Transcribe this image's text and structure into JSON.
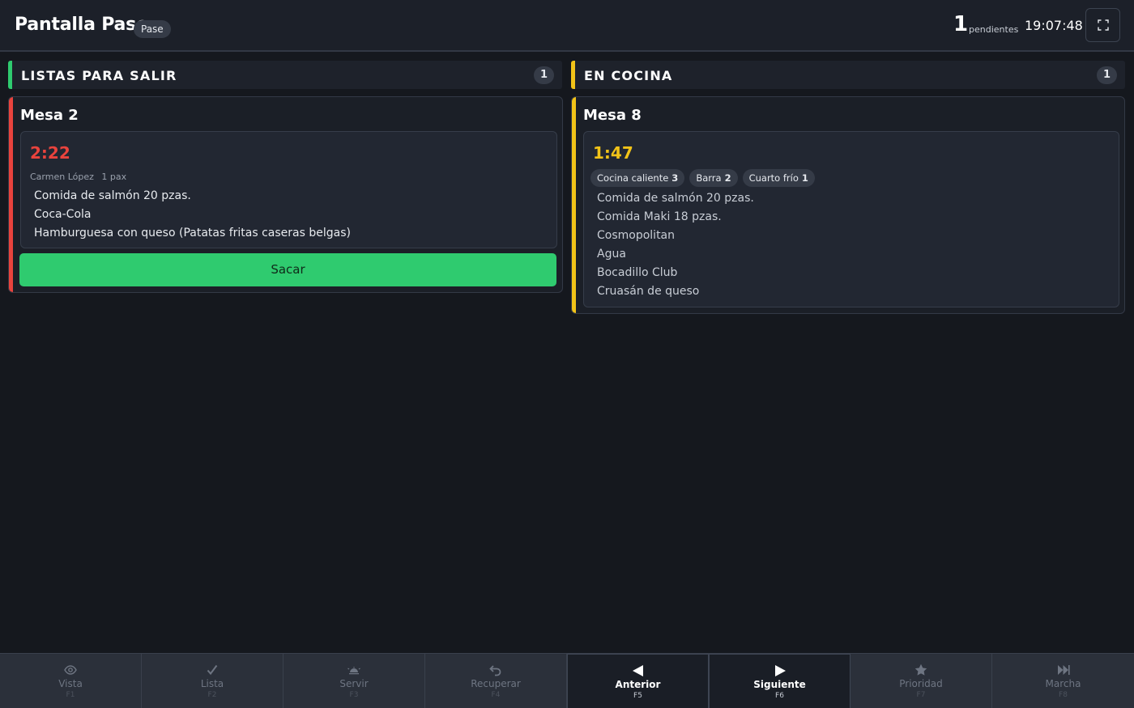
{
  "header": {
    "title": "Pantalla Pase",
    "badge": "Pase",
    "pending_count": "1",
    "pending_label": "pendientes",
    "clock": "19:07:48",
    "fullscreen_icon": "expand-icon"
  },
  "colors": {
    "ready": "#2fcb6f",
    "cooking": "#f2c318",
    "late": "#e9433d",
    "background": "#15181e"
  },
  "columns": [
    {
      "label": "LISTAS PARA SALIR",
      "count": "1",
      "card": {
        "mesa": "Mesa 2",
        "timer": "2:22",
        "waiter": "Carmen López",
        "pax": "1 pax",
        "items": [
          "Comida de salmón 20 pzas.",
          "Coca-Cola",
          "Hamburguesa con queso (Patatas fritas caseras belgas)"
        ],
        "action_label": "Sacar"
      }
    },
    {
      "label": "EN COCINA",
      "count": "1",
      "card": {
        "mesa": "Mesa 8",
        "timer": "1:47",
        "stations": [
          {
            "name": "Cocina caliente",
            "count": "3"
          },
          {
            "name": "Barra",
            "count": "2"
          },
          {
            "name": "Cuarto frío",
            "count": "1"
          }
        ],
        "items": [
          "Comida de salmón 20 pzas.",
          "Comida Maki 18 pzas.",
          "Cosmopolitan",
          "Agua",
          "Bocadillo Club",
          "Cruasán de queso"
        ]
      }
    }
  ],
  "toolbar": [
    {
      "label": "Vista",
      "key": "F1",
      "icon": "eye-icon",
      "active": false
    },
    {
      "label": "Lista",
      "key": "F2",
      "icon": "check-icon",
      "active": false
    },
    {
      "label": "Servir",
      "key": "F3",
      "icon": "cloche-icon",
      "active": false
    },
    {
      "label": "Recuperar",
      "key": "F4",
      "icon": "undo-arrow-icon",
      "active": false
    },
    {
      "label": "Anterior",
      "key": "F5",
      "icon": "triangle-left-icon",
      "active": true
    },
    {
      "label": "Siguiente",
      "key": "F6",
      "icon": "triangle-right-icon",
      "active": true
    },
    {
      "label": "Prioridad",
      "key": "F7",
      "icon": "star-icon",
      "active": false
    },
    {
      "label": "Marcha",
      "key": "F8",
      "icon": "skip-forward-icon",
      "active": false
    }
  ]
}
